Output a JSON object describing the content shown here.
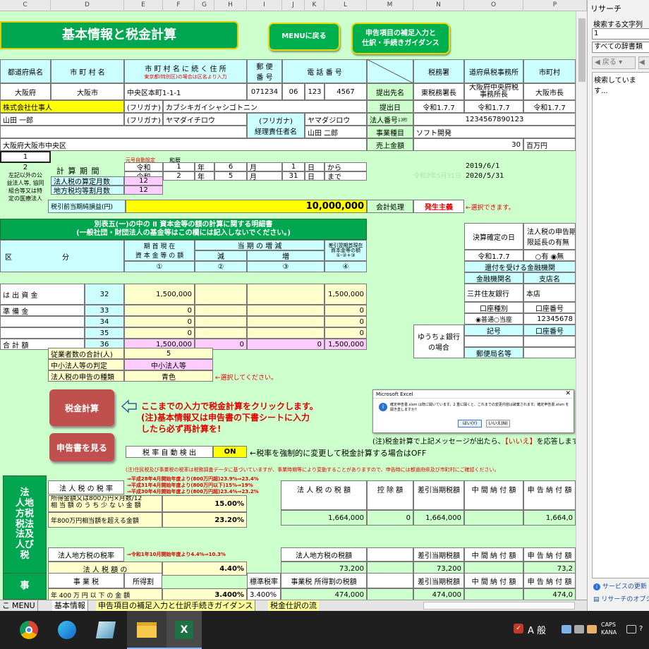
{
  "colors": {
    "sheet_bg": "#ccffcc",
    "header_green": "#00a650",
    "input_yellow": "#ffffcc",
    "label_cyan": "#ccffff",
    "pink": "#ffccff",
    "highlight": "#ffff00",
    "button_red": "#c0504d"
  },
  "col_headers": [
    "C",
    "D",
    "E",
    "F",
    "G",
    "H",
    "I",
    "J",
    "K",
    "L",
    "M",
    "N",
    "O",
    "P"
  ],
  "title": "基本情報と税金計算",
  "buttons": {
    "menu": "MENUに戻る",
    "guidance_l1": "申告項目の補足入力と",
    "guidance_l2": "仕訳・手続きガイダンス",
    "tax_calc": "税金計算",
    "print": "申告書を見る"
  },
  "hdr": {
    "pref": "都道府県名",
    "city": "市 町 村 名",
    "addr": "市 町 村 名 に 続 く 住 所",
    "addr_note": "東京都(特別区)の場合は区名より入力",
    "zip_l1": "郵 便",
    "zip_l2": "番 号",
    "tel": "電 話 番 号",
    "office": "税務署",
    "pref_office": "道府県税事務所",
    "city_office": "市町村"
  },
  "row1": {
    "pref": "大阪府",
    "city": "大阪市",
    "addr": "中央区本町1-1-1",
    "zip": "071234",
    "tel1": "06",
    "tel2": "123",
    "tel3": "4567",
    "submit_to": "提出先名",
    "office": "東税務署長",
    "pref_office_l1": "大阪府中央府税",
    "pref_office_l2": "事務所長",
    "city_office": "大阪市長"
  },
  "row2": {
    "company": "株式会社仕事人",
    "furi": "(フリガナ)",
    "furi_val": "カブシキガイシャシゴトニン",
    "submit_date": "提出日",
    "date1": "令和1.7.7",
    "date2": "令和1.7.7",
    "date3": "令和1.7.7"
  },
  "row3": {
    "rep": "山田 一郎",
    "furi": "(フリガナ)",
    "furi_val": "ヤマダイチロウ",
    "acc_furi": "(フリガナ)",
    "acc_furi_val": "ヤマダジロウ",
    "acc_label_l1": "経理責任者名",
    "acc_name": "山田 二郎",
    "corp_no_label": "法人番号",
    "corp_no_small": "13桁",
    "corp_no": "1234567890123",
    "biz_label": "事業種目",
    "biz": "ソフト開発"
  },
  "row4": {
    "addr2": "大阪府大阪市中央区",
    "sales_label": "売上金額",
    "sales_val": "30",
    "sales_unit": "百万円"
  },
  "period": {
    "sel1": "1",
    "sel2": "2",
    "era_note": "元号自動設定",
    "era_hdr": "和暦",
    "label": "計 算 期 間",
    "era1": "令和",
    "y1": "1",
    "m1": "6",
    "d1": "1",
    "era2": "令和",
    "y2": "2",
    "m2": "5",
    "d2": "31",
    "year": "年",
    "month": "月",
    "day": "日",
    "from": "から",
    "to": "まで",
    "date_from": "2019/6/1",
    "date_to": "2020/5/31",
    "ghost": "令和2年5月31日"
  },
  "left_note": [
    "左記以外の公",
    "益法人等, 協同",
    "組合等又は特",
    "定の医療法人"
  ],
  "months": {
    "label1": "法人税の算定月数",
    "val1": "12",
    "label2": "地方税均等割月数",
    "val2": "12"
  },
  "pretax": {
    "label": "税引前当期純損益(円)",
    "value": "10,000,000",
    "acct_label": "会計処理",
    "acct_val": "発生主義",
    "hint": "←選択できます。"
  },
  "schedule": {
    "title_l1": "別表五(一)の中の Ⅱ 資本金等の額の計算に関する明細書",
    "title_l2": "(一般社団・財団法人の基金等はこの欄には記入しないでください。)",
    "h_ku": "区",
    "h_bun": "分",
    "h_kishu_l1": "期 首 現 在",
    "h_kishu_l2": "資 本 金 等 の 額",
    "h_zougen": "当 期 の 増 減",
    "h_gen": "減",
    "h_zou": "増",
    "h_end_l1": "差引翌期首現在",
    "h_end_l2": "資本金等の額",
    "h_end_l3": "①-②+③",
    "n1": "①",
    "n2": "②",
    "n3": "③",
    "n4": "④",
    "rows": [
      {
        "label": "は 出 資 金",
        "no": "32",
        "c1": "1,500,000",
        "c2": "",
        "c3": "",
        "c4": "1,500,000"
      },
      {
        "label": "準 備 金",
        "no": "33",
        "c1": "0",
        "c2": "",
        "c3": "",
        "c4": "0"
      },
      {
        "label": "",
        "no": "34",
        "c1": "0",
        "c2": "",
        "c3": "",
        "c4": "0"
      },
      {
        "label": "",
        "no": "35",
        "c1": "0",
        "c2": "",
        "c3": "",
        "c4": "0"
      },
      {
        "label": "合 計 額",
        "no": "36",
        "c1": "1,500,000",
        "c2": "0",
        "c3": "0",
        "c4": "1,500,000"
      }
    ]
  },
  "right_panel": {
    "kessan": "決算確定の日",
    "ext_l1": "法人税の申告期",
    "ext_l2": "限延長の有無",
    "kessan_val": "令和1.7.7",
    "radio": "○有 ◉無",
    "bank_hdr": "還付を受ける金融機関",
    "bank_name_label": "金融機関名",
    "branch_label": "支店名",
    "bank_name": "三井住友銀行",
    "branch": "本店",
    "acct_type_label": "口座種別",
    "acct_no_label": "口座番号",
    "acct_type_val": "◉普通○当座",
    "acct_no": "12345678",
    "yucho_l1": "ゆうちょ銀行",
    "yucho_l2": "の場合",
    "kigo": "記号",
    "yucho_no": "口座番号",
    "post_office": "郵便局名等"
  },
  "summary": {
    "emp_label": "従業者数の合計(人)",
    "emp_val": "5",
    "sme_label": "中小法人等の判定",
    "sme_val": "中小法人等",
    "form_label": "法人税の申告の種類",
    "form_val": "青色",
    "form_hint": "←選択してください。"
  },
  "instructions": {
    "l1": "ここまでの入力で税金計算をクリックします。",
    "l2": "(注)基本情報又は申告書の下書シートに入力",
    "l3": "したら必ず再計算を!"
  },
  "dialog": {
    "title": "Microsoft Excel",
    "msg": "確定申告書.xlsm は既に開いています。2 重に開くと、これまでの変更内容は破棄されます。確定申告書.xlsm を開き直しますか?",
    "yes": "はい(Y)",
    "no": "いいえ(N)",
    "note_pre": "(注)税金計算で上記メッセージが出たら、",
    "note_red": "【いいえ】",
    "note_post": "を応答します"
  },
  "auto": {
    "label": "税 率 自 動 検 出",
    "val": "ON",
    "hint": "←税率を強制的に変更して税金計算する場合はOFF"
  },
  "notice": "(注)住民税及び事業税の税率は税務調査データに基づいていますが、事業時期等により変動することがありますので、申告時には都道府県及び市町村にご確認ください。",
  "rates": {
    "side": "法人税地方法人税及び税",
    "side_chars": [
      "法",
      "人地",
      "方税",
      "税法",
      "法及",
      "人び",
      "税"
    ],
    "corp_rate_label": "法 人 税 の 税 率",
    "notes": [
      "⇒平成28年4月開始年度より(800万円超)23.9%⇒23.4%",
      "⇒平成31年4月開始年度より(800万円以下)15%⇒19%",
      "⇒平成30年4月開始年度より(800万円超)23.4%⇒23.2%"
    ],
    "r1_l1": "所得金額又は800万円×月数/12",
    "r1_l2": "相 当 額 の う ち 少 な い 金 額",
    "r1_val": "15.00%",
    "r2_label": "年800万円相当額を超える金額",
    "r2_val": "23.20%",
    "local_label": "法人地方税の税率",
    "local_note": "⇒令和1年10月開始年度より4.4%⇒10.3%",
    "local_sub": "法 人 税 額 の",
    "local_val": "4.40%"
  },
  "tax_tbl": {
    "h1": "法 人 税 の 税 額",
    "h2": "控 除 額",
    "h3": "差引当期税額",
    "h4": "中 間 納 付 額",
    "h5": "申 告 納 付 額",
    "v1": "1,664,000",
    "v2": "0",
    "v3": "1,664,000",
    "v4": "",
    "v5": "1,664,0",
    "h6": "法人地方税の税額",
    "h7": "差引当期税額",
    "h8": "中 間 納 付 額",
    "h9": "申 告 納 付 額",
    "v6": "73,200",
    "v7": "73,200",
    "v8": "",
    "v9": "73,2"
  },
  "biz_tax": {
    "side": "事",
    "label": "事 業 税",
    "sub": "所得割",
    "std_label": "標準税率",
    "tbl_label": "事業税 所得割の税額",
    "h3": "差引当期税額",
    "h4": "中 間 納 付 額",
    "h5": "申 告 納 付 額",
    "row_label": "年 400 万 円 以 下 の 金 額",
    "rate": "3.400%",
    "std": "3.400%",
    "v1": "474,000",
    "v3": "474,000",
    "v5": "474,0"
  },
  "tabs": [
    "こ",
    "MENU",
    "基本情報",
    "申告項目の補足入力と仕訳手続きガイダンス",
    "税金仕訳の流"
  ],
  "pane": {
    "title": "リサーチ",
    "search_label": "検索する文字列",
    "search_val": "1",
    "scope": "すべての辞書類",
    "back": "戻る",
    "status": "検索しています...",
    "link1": "サービスの更新",
    "link2": "リサーチのオプシ"
  },
  "taskbar": {
    "ime": "A 般",
    "caps": "CAPS",
    "kana": "KANA"
  }
}
